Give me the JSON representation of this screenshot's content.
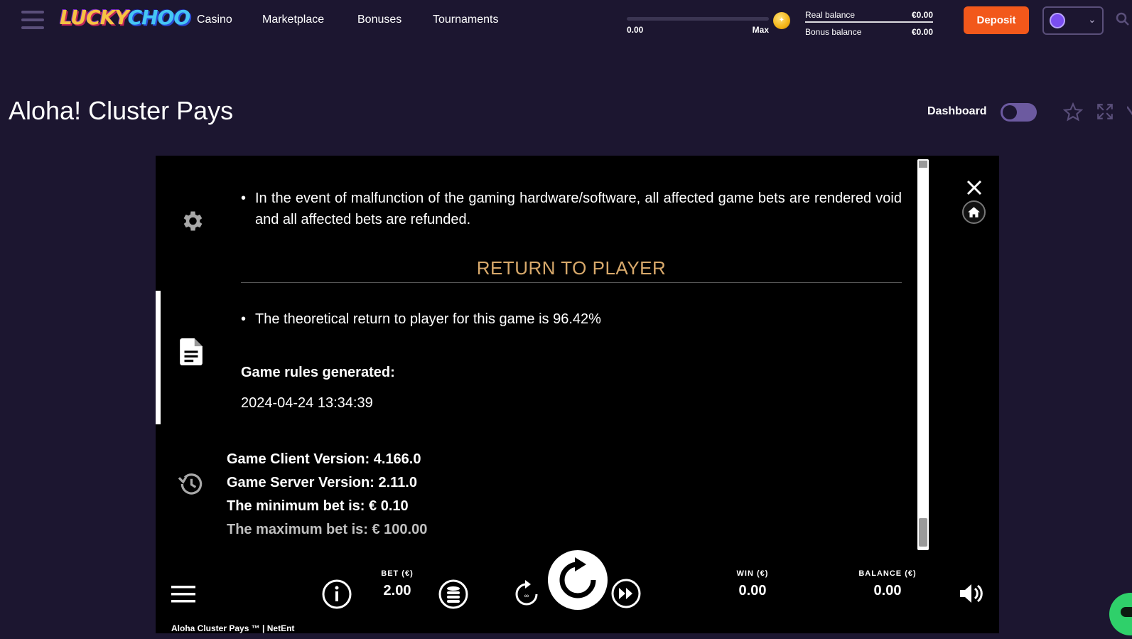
{
  "header": {
    "logo": {
      "part1": "LUCKY",
      "part2": "CHOO"
    },
    "nav": [
      "Casino",
      "Marketplace",
      "Bonuses",
      "Tournaments"
    ],
    "progress": {
      "min": "0.00",
      "max": "Max",
      "fraction": 0.0
    },
    "balances": {
      "real_label": "Real balance",
      "real_value": "€0.00",
      "bonus_label": "Bonus balance",
      "bonus_value": "€0.00"
    },
    "deposit_label": "Deposit"
  },
  "page": {
    "title": "Aloha! Cluster Pays",
    "dashboard_label": "Dashboard",
    "dashboard_toggle": "off"
  },
  "game": {
    "rules": {
      "malfunction": "In the event of malfunction of the gaming hardware/software, all affected game bets are rendered void and all affected bets are refunded.",
      "rtp_title": "RETURN TO PLAYER",
      "rtp_text": "The theoretical return to player for this game is 96.42%",
      "generated_title": "Game rules generated:",
      "generated_date": "2024-04-24 13:34:39"
    },
    "versions": {
      "client": "Game Client Version: 4.166.0",
      "server": "Game Server Version: 2.11.0",
      "min_bet": "The minimum bet is: € 0.10",
      "max_bet": "The maximum bet is: € 100.00"
    },
    "controls": {
      "bet_label": "BET (€)",
      "bet_value": "2.00",
      "win_label": "WIN (€)",
      "win_value": "0.00",
      "balance_label": "BALANCE (€)",
      "balance_value": "0.00"
    },
    "footer": "Aloha Cluster Pays ™  |  NetEnt"
  },
  "colors": {
    "page_bg": "#1c1630",
    "deposit": "#f2581b",
    "rtp_title": "#d8a96b",
    "toggle": "#6c5aa0",
    "chat": "#2fd06a"
  }
}
